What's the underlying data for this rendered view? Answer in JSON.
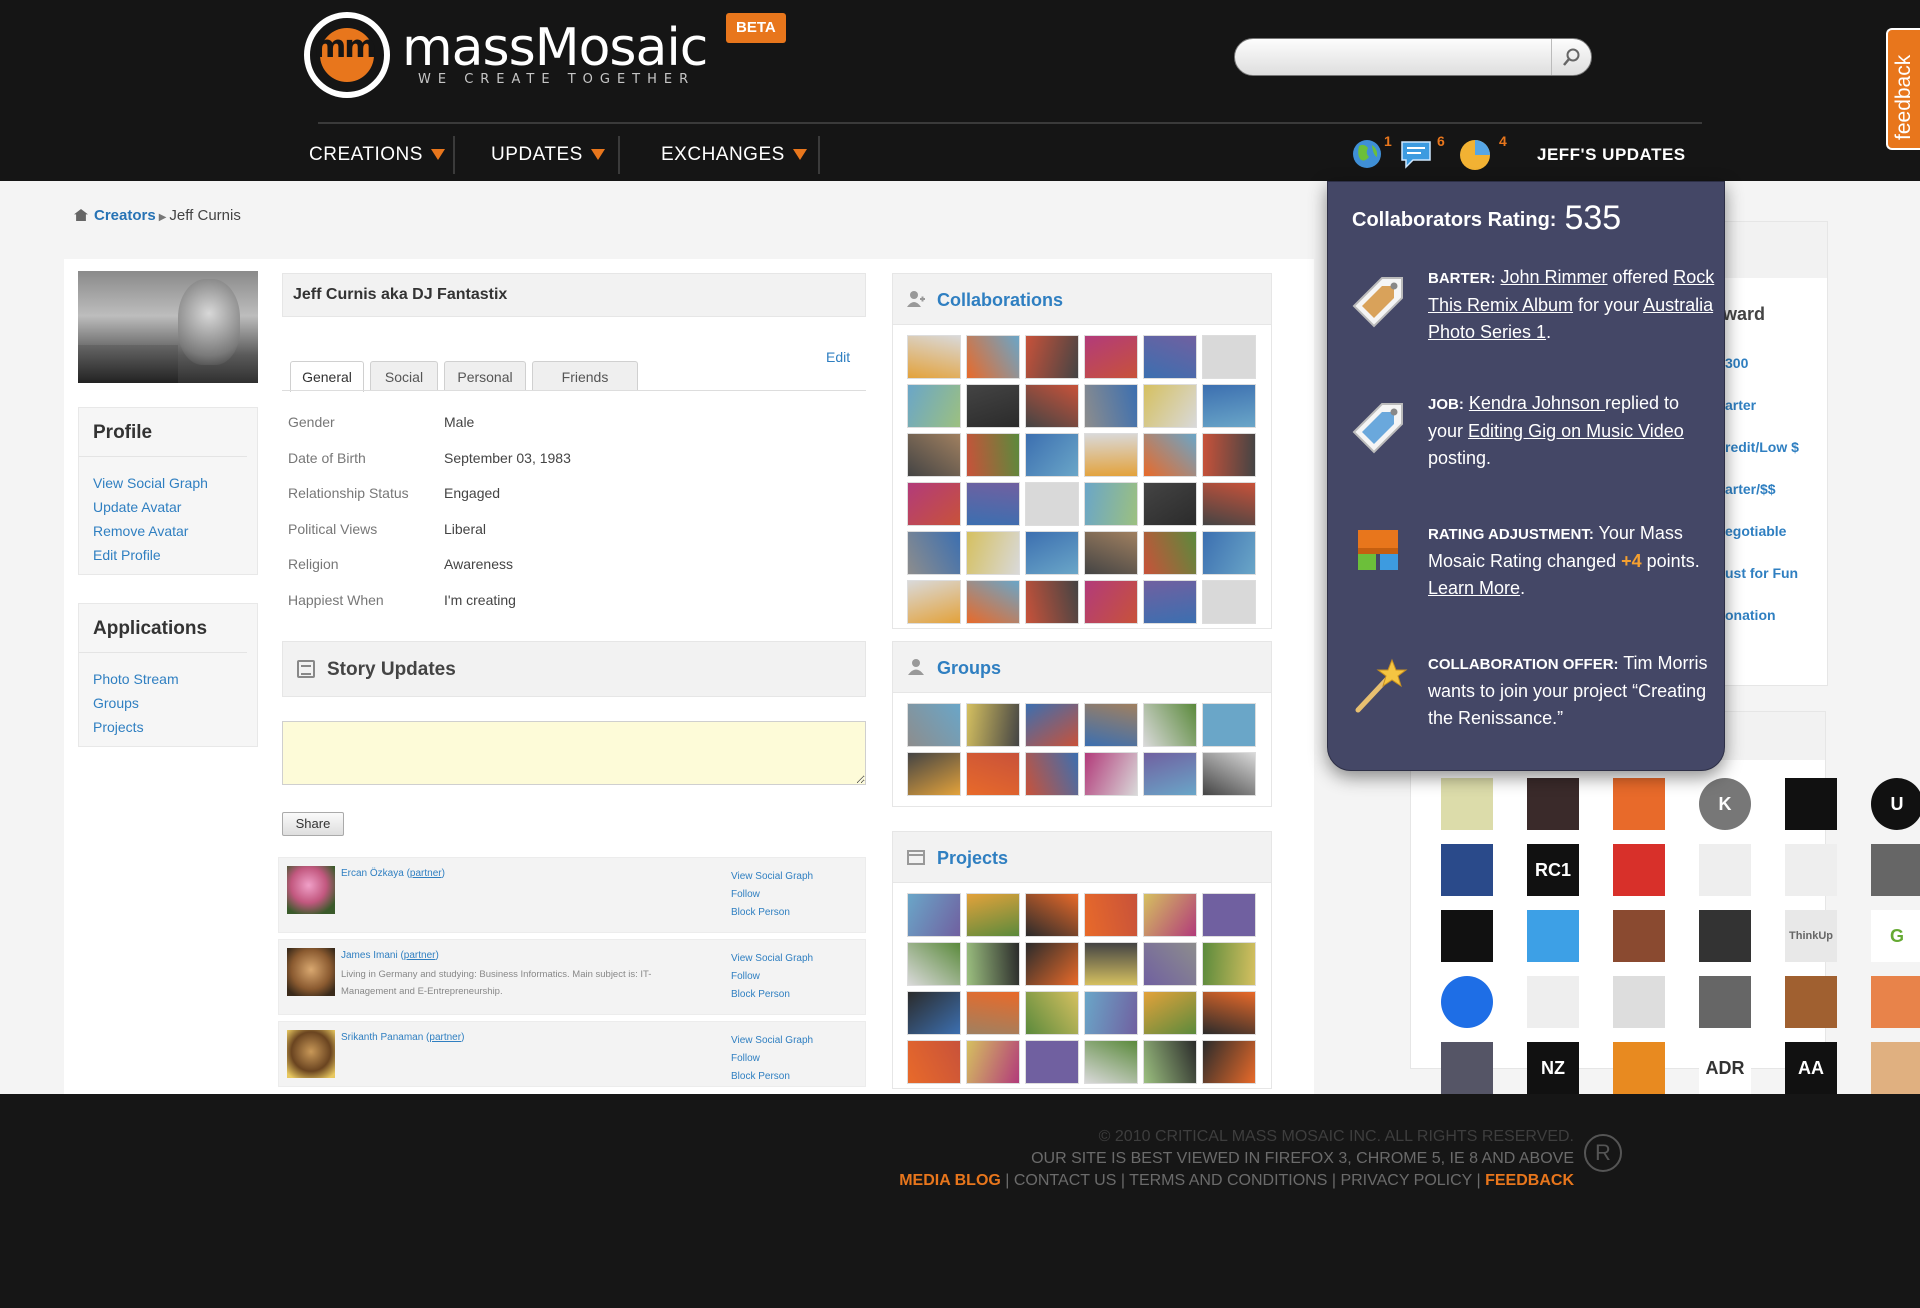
{
  "header": {
    "logo_text": "massMosaic",
    "logo_tagline": "WE CREATE TOGETHER",
    "logo_mark": "mm",
    "beta_badge": "BETA",
    "search": {
      "placeholder": "",
      "value": ""
    },
    "nav": [
      {
        "label": "CREATIONS"
      },
      {
        "label": "UPDATES"
      },
      {
        "label": "EXCHANGES"
      }
    ],
    "notifications": [
      {
        "icon": "globe-icon",
        "count": "1"
      },
      {
        "icon": "chat-icon",
        "count": "6"
      },
      {
        "icon": "pie-chart-icon",
        "count": "4"
      }
    ],
    "user_updates": "JEFF'S UPDATES",
    "feedback_tab": "feedback"
  },
  "breadcrumb": {
    "parent": "Creators",
    "current": "Jeff Curnis"
  },
  "profile": {
    "display_name": "Jeff Curnis aka DJ Fantastix",
    "edit_label": "Edit",
    "tabs": [
      "General",
      "Social",
      "Personal",
      "Friends"
    ],
    "fields": [
      {
        "label": "Gender",
        "value": "Male"
      },
      {
        "label": "Date of Birth",
        "value": "September 03, 1983"
      },
      {
        "label": "Relationship Status",
        "value": "Engaged"
      },
      {
        "label": "Political Views",
        "value": "Liberal"
      },
      {
        "label": "Religion",
        "value": "Awareness"
      },
      {
        "label": "Happiest When",
        "value": "I'm creating"
      }
    ]
  },
  "sidebar": {
    "profile_title": "Profile",
    "profile_links": [
      "View Social Graph",
      "Update Avatar",
      "Remove Avatar",
      "Edit Profile"
    ],
    "apps_title": "Applications",
    "app_links": [
      "Photo Stream",
      "Groups",
      "Projects"
    ]
  },
  "story": {
    "title": "Story Updates",
    "input_value": "",
    "share_label": "Share",
    "feed": [
      {
        "name": "Ercan Özkaya",
        "tag": "partner",
        "desc": "",
        "actions": [
          "View Social Graph",
          "Follow",
          "Block Person"
        ]
      },
      {
        "name": "James Imani",
        "tag": "partner",
        "desc": "Living in Germany and studying: Business Informatics. Main subject is: IT-Management and E-Entrepreneurship.",
        "actions": [
          "View Social Graph",
          "Follow",
          "Block Person"
        ]
      },
      {
        "name": "Srikanth Panaman",
        "tag": "partner",
        "desc": "",
        "actions": [
          "View Social Graph",
          "Follow",
          "Block Person"
        ]
      }
    ]
  },
  "galleries": {
    "collaborations": {
      "title": "Collaborations",
      "icon": "person-add-icon"
    },
    "groups": {
      "title": "Groups",
      "icon": "group-icon"
    },
    "projects": {
      "title": "Projects",
      "icon": "folder-icon"
    }
  },
  "right_panel": {
    "partial_title": "ward",
    "partial_links": [
      "300",
      "arter",
      "redit/Low $",
      "arter/$$",
      "egotiable",
      "ust for Fun",
      "onation"
    ]
  },
  "logos": [
    "",
    "",
    "",
    "K",
    "",
    "U",
    "",
    "RC1",
    "",
    "",
    "",
    "",
    "",
    "",
    "",
    "",
    "ThinkUp",
    "G",
    "",
    "",
    "",
    "",
    "",
    "",
    "",
    "NZ",
    "",
    "ADR",
    "AA",
    ""
  ],
  "popup": {
    "rating_label": "Collaborators Rating:",
    "rating_value": "535",
    "items": [
      {
        "icon": "barter-tag-icon",
        "label": "BARTER:",
        "parts": [
          "John Rimmer",
          " offered ",
          "Rock This Remix Album",
          " for your ",
          "Australia Photo Series 1",
          "."
        ]
      },
      {
        "icon": "job-tag-icon",
        "label": "JOB:",
        "parts": [
          "Kendra Johnson ",
          " replied to your ",
          "Editing Gig on Music Video",
          " posting."
        ]
      },
      {
        "icon": "rating-adjustment-icon",
        "label": "RATING ADJUSTMENT:",
        "parts": [
          " Your Mass Mosaic Rating changed ",
          "+4",
          " points. ",
          "Learn More",
          "."
        ]
      },
      {
        "icon": "magic-wand-icon",
        "label": "COLLABORATION OFFER:",
        "parts": [
          " Tim Morris wants to join your project “Creating the Renissance.”"
        ]
      }
    ]
  },
  "footer": {
    "copyright": "© 2010 CRITICAL MASS MOSAIC INC. ALL RIGHTS RESERVED.",
    "browser_note": "OUR SITE IS BEST VIEWED IN FIREFOX 3, CHROME 5, IE 8 AND ABOVE",
    "links": [
      "MEDIA BLOG",
      "CONTACT US",
      "TERMS AND CONDITIONS",
      "PRIVACY POLICY",
      "FEEDBACK"
    ],
    "reg_mark": "R"
  },
  "colors": {
    "accent": "#e8761c",
    "link": "#2f7fc1",
    "popup_bg": "#444766",
    "header_bg": "#151515"
  }
}
